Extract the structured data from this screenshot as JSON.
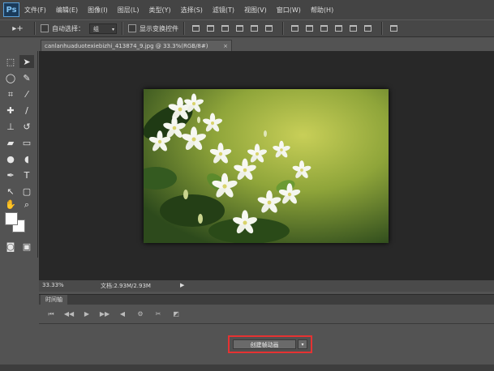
{
  "app": {
    "logo": "Ps"
  },
  "menu": [
    "文件(F)",
    "编辑(E)",
    "图像(I)",
    "图层(L)",
    "类型(Y)",
    "选择(S)",
    "滤镜(T)",
    "视图(V)",
    "窗口(W)",
    "帮助(H)"
  ],
  "options": {
    "tool_preset": "▸+",
    "auto_select_label": "自动选择：",
    "auto_select_value": "组",
    "show_transform_label": "显示变换控件"
  },
  "document": {
    "tab_title": "canlanhuaduotexiebizhi_413874_9.jpg @ 33.3%(RGB/8#)",
    "close": "×"
  },
  "status": {
    "zoom": "33.33%",
    "doc_size": "文档:2.93M/2.93M",
    "arrow": "▶"
  },
  "timeline": {
    "tab_label": "时间轴",
    "create_button": "创建帧动画",
    "dropdown": "▾"
  },
  "icons": {
    "move": "move-tool-icon",
    "marquee": "rectangular-marquee-icon",
    "lasso": "lasso-icon",
    "magic_wand": "quick-select-icon",
    "crop": "crop-icon",
    "eyedropper": "eyedropper-icon",
    "healing": "healing-brush-icon",
    "brush": "brush-icon",
    "stamp": "clone-stamp-icon",
    "history_brush": "history-brush-icon",
    "eraser": "eraser-icon",
    "gradient": "gradient-icon",
    "blur": "blur-icon",
    "dodge": "dodge-icon",
    "pen": "pen-icon",
    "text": "type-icon",
    "path_select": "path-selection-icon",
    "shape": "rectangle-shape-icon",
    "hand": "hand-icon",
    "zoom": "zoom-icon"
  },
  "colors": {
    "highlight": "#e53232",
    "panel": "#535353",
    "canvas": "#282828"
  }
}
